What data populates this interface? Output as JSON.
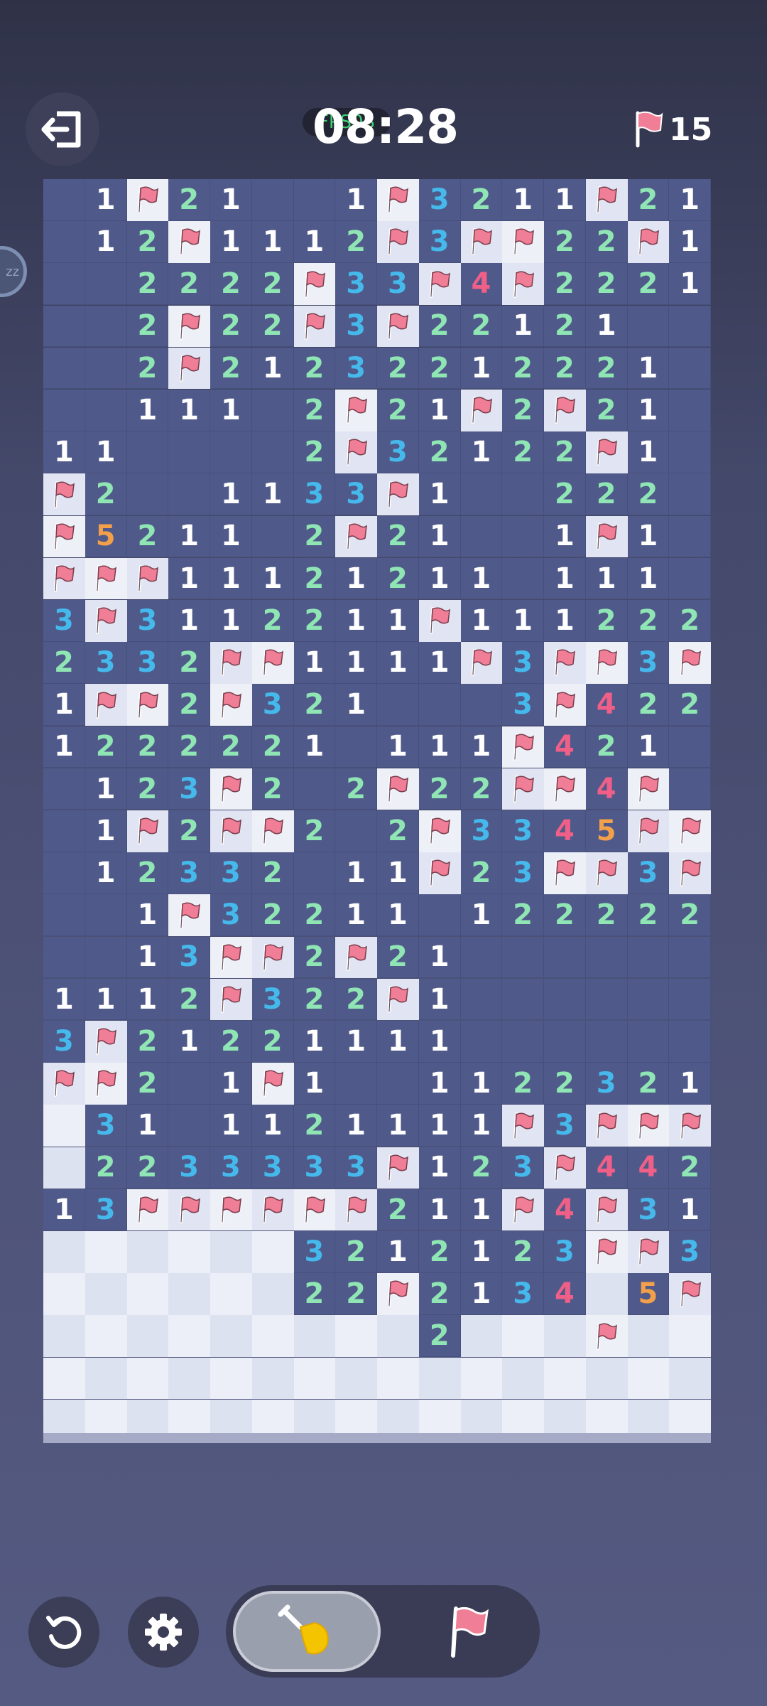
{
  "header": {
    "timer": "08:28",
    "fps_overlay": "FPS08",
    "flags_remaining": "15",
    "side_bubble_label": "zz",
    "exit_icon": "exit-icon",
    "flag_icon": "flag-icon"
  },
  "colors": {
    "open": "#505a8a",
    "covered_light": "#eceff8",
    "covered_dark": "#dde2f1",
    "n1": "#ffffff",
    "n2": "#8fe6b4",
    "n3": "#45b9ec",
    "n4": "#ef5f87",
    "n5": "#f3a04a",
    "flag": "#f07e96"
  },
  "board": {
    "columns": 16,
    "rows": 30,
    "legend": ". open empty, digit = number, F = flag, # = covered",
    "grid": [
      ".1F21..1F3211F21",
      ".12F1112F3FF22F1",
      "..2222F33F4F2221",
      "..2F22F3F22121..",
      "..2F21232212221.",
      "..111.2F21F2F21.",
      "11....2F32122F1.",
      "F2..1133F1..222.",
      "F5211.2F21..1F1.",
      "FFF11121211.111.",
      "3F3112211F111222",
      "2332FF1111F3FF3F",
      "1FF2F321...3F422",
      "1222221.111F421.",
      ".123F2.2F22FF4F.",
      ".1F2FF2.2F3345FF",
      ".12332.11F23FF3F",
      "..1F32211.122222",
      "..13FF2F21......",
      "1112F322F1......",
      "3F21221111......",
      "FF2.1F1..1122321",
      "#31.1121111F3FFF",
      "#2233333F123F442",
      "13FFFFFF211F4F31",
      "######3212123FF32",
      "######22F2134 5FF",
      "#########2###F##",
      "################",
      "################"
    ]
  },
  "toolbar": {
    "undo_icon": "undo-icon",
    "settings_icon": "gear-icon",
    "dig_icon": "shovel-icon",
    "flag_mode_icon": "flag-icon"
  }
}
